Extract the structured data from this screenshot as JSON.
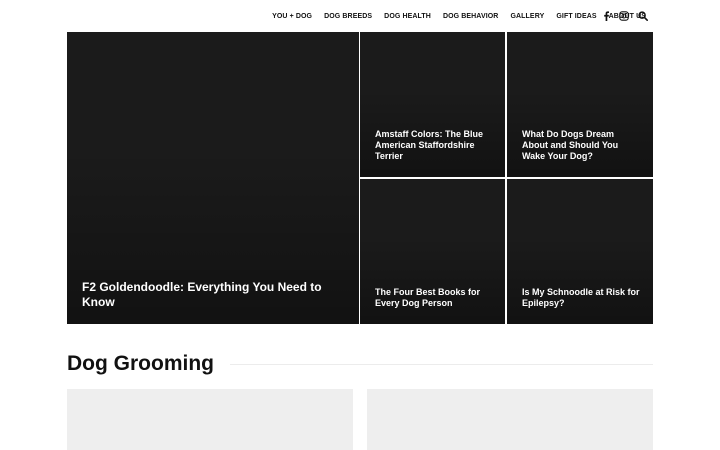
{
  "nav": {
    "items": [
      "YOU + DOG",
      "DOG BREEDS",
      "DOG HEALTH",
      "DOG BEHAVIOR",
      "GALLERY",
      "GIFT IDEAS",
      "ABOUT US"
    ]
  },
  "icons": {
    "facebook": "facebook-icon",
    "instagram": "instagram-icon",
    "search": "search-icon"
  },
  "featured": {
    "main": {
      "title": "F2 Goldendoodle: Everything You Need to Know"
    },
    "small": [
      {
        "title": "Amstaff Colors: The Blue American Staffordshire Terrier"
      },
      {
        "title": "What Do Dogs Dream About and Should You Wake Your Dog?"
      },
      {
        "title": "The Four Best Books for Every Dog Person"
      },
      {
        "title": "Is My Schnoodle at Risk for Epilepsy?"
      }
    ]
  },
  "section": {
    "title": "Dog Grooming"
  }
}
